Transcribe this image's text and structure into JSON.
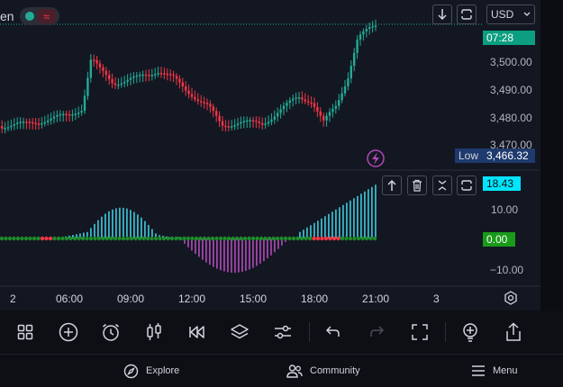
{
  "header": {
    "symbol_suffix": "en",
    "currency": "USD"
  },
  "price_axis": {
    "labels": [
      "3,500.00",
      "3,490.00",
      "3,480.00",
      "3,470.00"
    ],
    "countdown": "07:28",
    "low_label": "Low",
    "low_value": "3,466.32"
  },
  "indicator_axis": {
    "current_value": "18.43",
    "labels": [
      "10.00",
      "0.00",
      "−10.00"
    ]
  },
  "time_axis": {
    "labels": [
      "2",
      "06:00",
      "09:00",
      "12:00",
      "15:00",
      "18:00",
      "21:00",
      "3"
    ]
  },
  "icons": {
    "scroll_down": "arrow-down-icon",
    "reset": "reset-scale-icon",
    "lightning": "lightning-icon",
    "move_up": "arrow-up-icon",
    "delete": "trash-icon",
    "collapse": "collapse-icon",
    "settings": "settings-icon"
  },
  "toolbar": [
    {
      "name": "layout-icon"
    },
    {
      "name": "add-icon"
    },
    {
      "name": "alarm-icon"
    },
    {
      "name": "candles-icon"
    },
    {
      "name": "replay-icon"
    },
    {
      "name": "layers-icon"
    },
    {
      "name": "settings-sliders-icon"
    },
    {
      "name": "undo-icon"
    },
    {
      "name": "redo-icon"
    },
    {
      "name": "fullscreen-icon"
    },
    {
      "name": "ideas-icon"
    },
    {
      "name": "share-icon"
    }
  ],
  "nav": {
    "explore": "Explore",
    "community": "Community",
    "menu": "Menu"
  },
  "colors": {
    "up": "#22ab94",
    "down": "#f23645",
    "background": "#131722",
    "hist_up": "#3fc6d8",
    "hist_down": "#b04ab8",
    "zero_dots": "#1e8a2a",
    "accent_cyan": "#00e5ff",
    "countdown_bg": "#0b9e80",
    "low_bg": "#1e3a6e"
  }
}
